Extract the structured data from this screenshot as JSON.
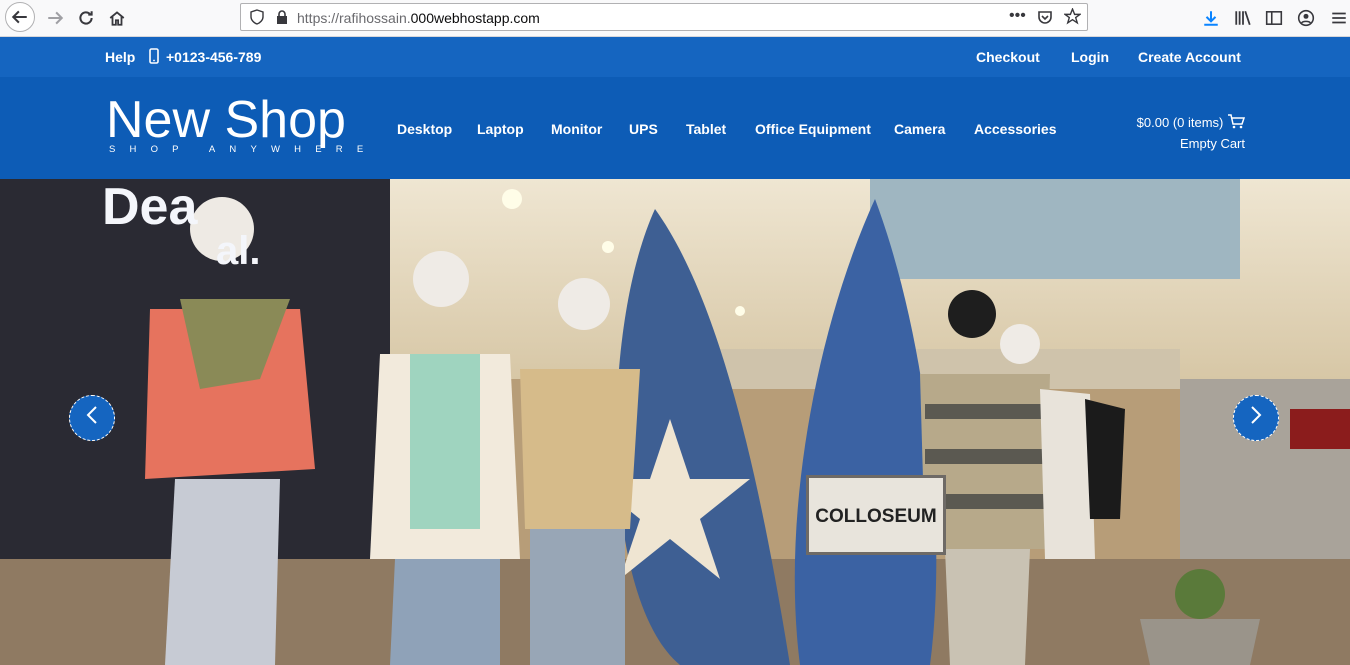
{
  "browser": {
    "url_prefix": "https://rafihossain.",
    "url_domain": "000webhostapp.com"
  },
  "topbar": {
    "help": "Help",
    "phone": "+0123-456-789",
    "checkout": "Checkout",
    "login": "Login",
    "create_account": "Create Account"
  },
  "brand": {
    "name": "New Shop",
    "tagline": "SHOP ANYWHERE"
  },
  "nav": [
    "Desktop",
    "Laptop",
    "Monitor",
    "UPS",
    "Tablet",
    "Office Equipment",
    "Camera",
    "Accessories"
  ],
  "cart": {
    "summary": "$0.00 (0 items)",
    "empty": "Empty Cart"
  },
  "hero": {
    "sign": "COLLOSEUM",
    "store_sign": "Dea",
    "store_sign2": "al."
  },
  "colors": {
    "topbar": "#1565c0",
    "header": "#0d5cb6",
    "accent": "#1565c0"
  }
}
